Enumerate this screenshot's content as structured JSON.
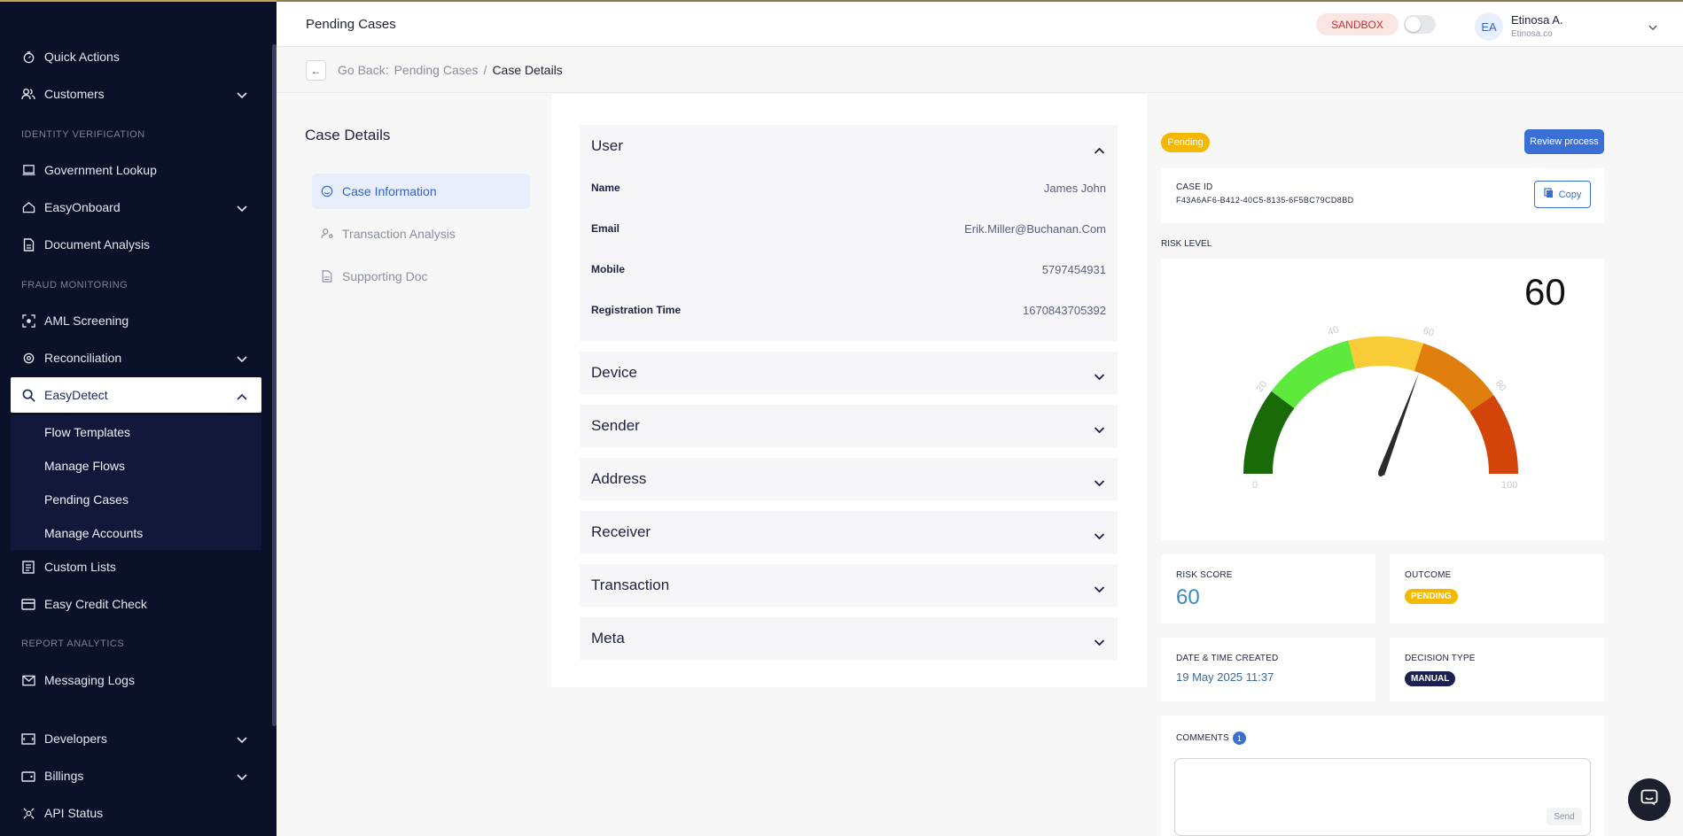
{
  "sidebar": {
    "items": {
      "quick_actions": "Quick Actions",
      "customers": "Customers",
      "government_lookup": "Government Lookup",
      "easyonboard": "EasyOnboard",
      "document_analysis": "Document Analysis",
      "aml_screening": "AML Screening",
      "reconciliation": "Reconciliation",
      "easydetect": "EasyDetect",
      "custom_lists": "Custom Lists",
      "easy_credit_check": "Easy Credit Check",
      "messaging_logs": "Messaging Logs",
      "developers": "Developers",
      "billings": "Billings",
      "api_status": "API Status"
    },
    "sections": {
      "identity": "IDENTITY VERIFICATION",
      "fraud": "FRAUD MONITORING",
      "report": "REPORT ANALYTICS"
    },
    "easydetect_sub": {
      "flow_templates": "Flow Templates",
      "manage_flows": "Manage Flows",
      "pending_cases": "Pending Cases",
      "manage_accounts": "Manage Accounts"
    }
  },
  "header": {
    "title": "Pending Cases",
    "sandbox": "SANDBOX",
    "avatar_initials": "EA",
    "user_name": "Etinosa A.",
    "user_org": "Etinosa.co"
  },
  "breadcrumb": {
    "back_arrow": "←",
    "go_back": "Go Back:",
    "parent": "Pending Cases",
    "separator": "/",
    "current": "Case Details"
  },
  "case_nav": {
    "title": "Case Details",
    "case_information": "Case Information",
    "transaction_analysis": "Transaction Analysis",
    "supporting_doc": "Supporting Doc"
  },
  "user_section": {
    "title": "User",
    "rows": {
      "name": {
        "label": "Name",
        "value": "James John"
      },
      "email": {
        "label": "Email",
        "value": "Erik.Miller@Buchanan.Com"
      },
      "mobile": {
        "label": "Mobile",
        "value": "5797454931"
      },
      "registration_time": {
        "label": "Registration Time",
        "value": "1670843705392"
      }
    }
  },
  "accordions": {
    "device": "Device",
    "sender": "Sender",
    "address": "Address",
    "receiver": "Receiver",
    "transaction": "Transaction",
    "meta": "Meta"
  },
  "status_panel": {
    "status_pill": "Pending",
    "review_button": "Review process",
    "case_id_label": "CASE ID",
    "case_id_value": "F43A6AF6-B412-40C5-8135-6F5BC79CD8BD",
    "copy_label": "Copy",
    "risk_level_label": "RISK LEVEL",
    "gauge_value": "60",
    "gauge_ticks": {
      "t0": "0",
      "t20": "20",
      "t40": "40",
      "t60": "60",
      "t80": "80",
      "t100": "100"
    },
    "risk_score_label": "RISK SCORE",
    "risk_score_value": "60",
    "outcome_label": "OUTCOME",
    "outcome_value": "PENDING",
    "date_label": "DATE & TIME CREATED",
    "date_value": "19 May 2025 11:37",
    "decision_type_label": "DECISION TYPE",
    "decision_type_value": "MANUAL",
    "comments_label": "COMMENTS",
    "comments_count": "1",
    "send_label": "Send"
  },
  "colors": {
    "sidebar_bg": "#0b1128",
    "accent_blue": "#3a6fd5",
    "pending_yellow": "#f5b800",
    "gauge_green_dark": "#1a6b07",
    "gauge_green_light": "#5ee93d",
    "gauge_yellow": "#f9cc37",
    "gauge_orange": "#e07f0e",
    "gauge_red": "#d3440a"
  }
}
